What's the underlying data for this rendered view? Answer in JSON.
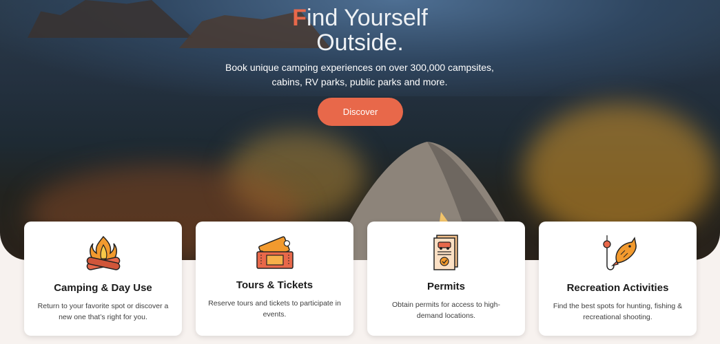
{
  "hero": {
    "headline_first_letter": "F",
    "headline_rest_line1": "ind Yourself",
    "headline_line2": "Outside.",
    "subtitle": "Book unique camping experiences on over 300,000 campsites, cabins, RV parks, public parks and more.",
    "cta_label": "Discover",
    "accent_color": "#e8684a"
  },
  "cards": [
    {
      "title": "Camping & Day Use",
      "description": "Return to your favorite spot or discover a new one that’s right for you.",
      "icon": "campfire-icon"
    },
    {
      "title": "Tours & Tickets",
      "description": "Reserve tours and tickets to participate in events.",
      "icon": "tickets-icon"
    },
    {
      "title": "Permits",
      "description": "Obtain permits for access to high-demand locations.",
      "icon": "permit-document-icon"
    },
    {
      "title": "Recreation Activities",
      "description": "Find the best spots for hunting, fishing & recreational shooting.",
      "icon": "fishing-icon"
    }
  ]
}
